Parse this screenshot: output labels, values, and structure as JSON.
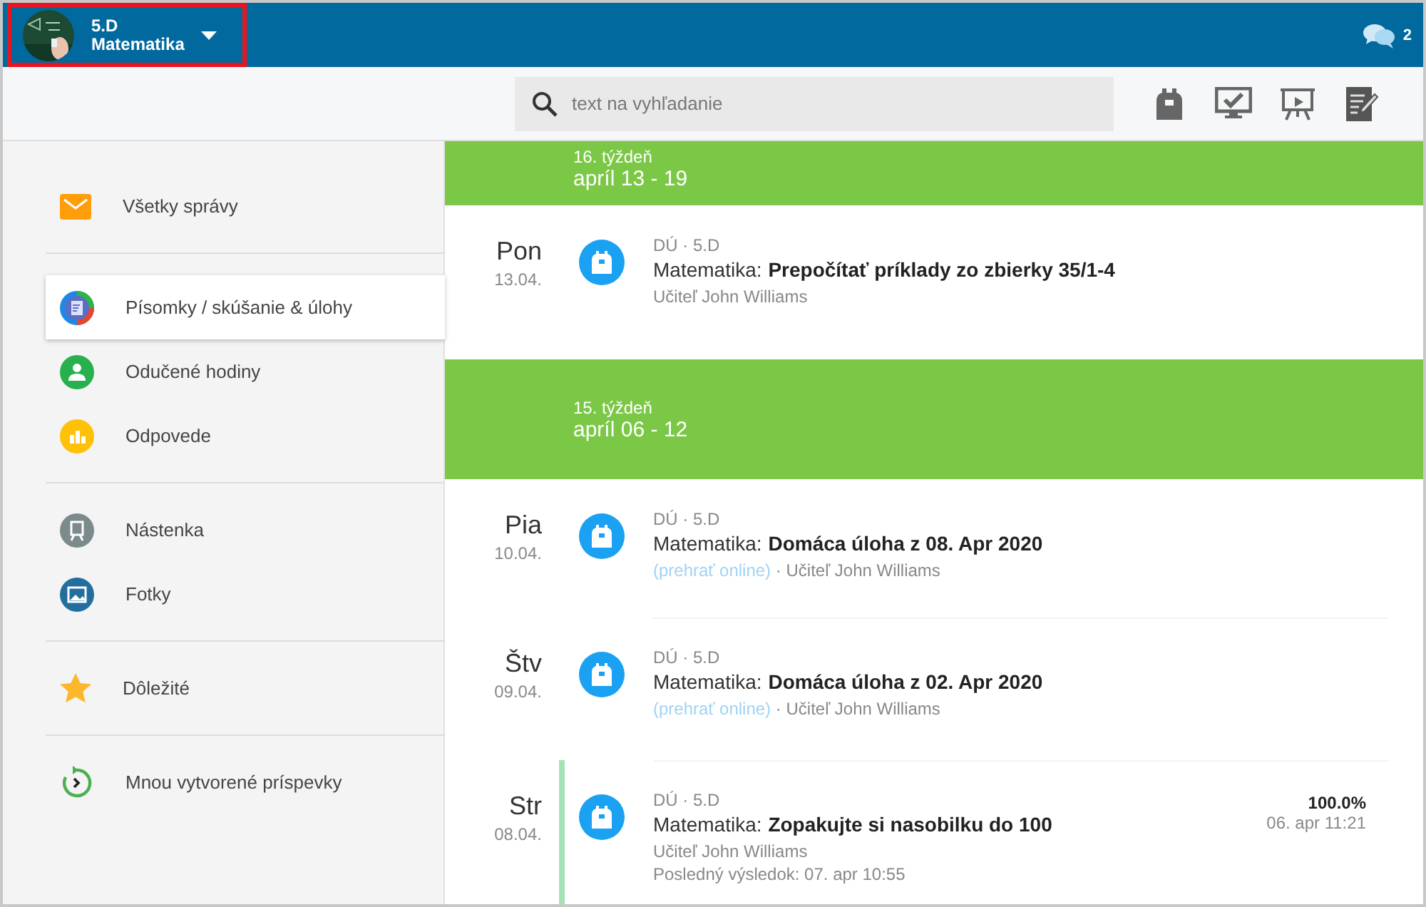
{
  "header": {
    "class_name": "5.D",
    "subject": "Matematika",
    "highlighted": true,
    "messages_count": "2"
  },
  "toolbar": {
    "search": {
      "placeholder": "text na vyhľadanie"
    },
    "tools": [
      {
        "kind": "backpack"
      },
      {
        "kind": "monitor"
      },
      {
        "kind": "presentation"
      },
      {
        "kind": "notepad"
      }
    ]
  },
  "sidebar": {
    "groups": [
      {
        "items": [
          {
            "label": "Všetky správy",
            "kind": "mail",
            "selected": false
          }
        ]
      },
      {
        "items": [
          {
            "label": "Písomky / skúšanie & úlohy",
            "kind": "tests",
            "selected": true
          },
          {
            "label": "Odučené hodiny",
            "kind": "lessons",
            "selected": false
          },
          {
            "label": "Odpovede",
            "kind": "answers",
            "selected": false
          }
        ]
      },
      {
        "items": [
          {
            "label": "Nástenka",
            "kind": "board",
            "selected": false
          },
          {
            "label": "Fotky",
            "kind": "photos",
            "selected": false
          }
        ]
      },
      {
        "items": [
          {
            "label": "Dôležité",
            "kind": "star",
            "selected": false
          }
        ]
      },
      {
        "items": [
          {
            "label": "Mnou vytvorené príspevky",
            "kind": "history",
            "selected": false
          }
        ]
      }
    ]
  },
  "weeks": [
    {
      "week": "16. týždeň",
      "range": "apríl 13 - 19",
      "entries": [
        {
          "day": "Pon",
          "date": "13.04.",
          "meta": "DÚ · 5.D",
          "subject": "Matematika:",
          "title": "Prepočítať príklady zo zbierky 35/1-4",
          "teacher": "Učiteľ John Williams",
          "marked": false
        }
      ]
    },
    {
      "week": "15. týždeň",
      "range": "apríl 06 - 12",
      "entries": [
        {
          "day": "Pia",
          "date": "10.04.",
          "meta": "DÚ · 5.D",
          "subject": "Matematika:",
          "title": "Domáca úloha z 08. Apr 2020",
          "link": "(prehrať online)",
          "separator": "·",
          "teacher": "Učiteľ John Williams",
          "marked": false
        },
        {
          "day": "Štv",
          "date": "09.04.",
          "meta": "DÚ · 5.D",
          "subject": "Matematika:",
          "title": "Domáca úloha z 02. Apr 2020",
          "link": "(prehrať online)",
          "separator": "·",
          "teacher": "Učiteľ John Williams",
          "marked": false
        },
        {
          "day": "Str",
          "date": "08.04.",
          "meta": "DÚ · 5.D",
          "subject": "Matematika:",
          "title": "Zopakujte si nasobilku do 100",
          "teacher": "Učiteľ John Williams",
          "last_result": "Posledný výsledok: 07. apr 10:55",
          "score": "100.0%",
          "score_time": "06. apr 11:21",
          "marked": true
        }
      ]
    }
  ]
}
